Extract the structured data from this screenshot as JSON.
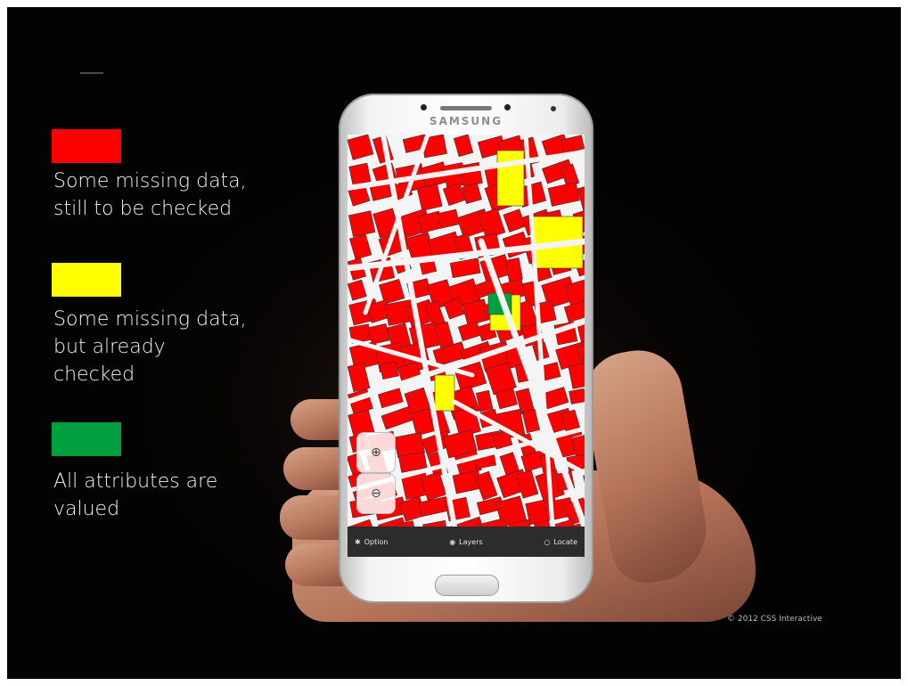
{
  "legend": {
    "items": [
      {
        "color": "#ff0000",
        "text": "Some missing data,\nstill to be checked"
      },
      {
        "color": "#ffff00",
        "text": "Some missing data,\nbut already\nchecked"
      },
      {
        "color": "#00a040",
        "text": "All attributes are\nvalued"
      }
    ]
  },
  "phone": {
    "brand": "SAMSUNG",
    "toolbar": {
      "options_label": "Option",
      "options_icon": "gear-icon",
      "layers_label": "Layers",
      "layers_icon": "eye-icon",
      "locate_label": "Locate",
      "locate_icon": "locate-icon"
    },
    "zoom": {
      "in_icon": "zoom-in-icon",
      "out_icon": "zoom-out-icon"
    },
    "map_colors": {
      "incomplete": "#ff0000",
      "checked": "#ffff00",
      "complete": "#00a040",
      "street": "#f4f4f4"
    }
  },
  "copyright": "© 2012 CSS Interactive"
}
